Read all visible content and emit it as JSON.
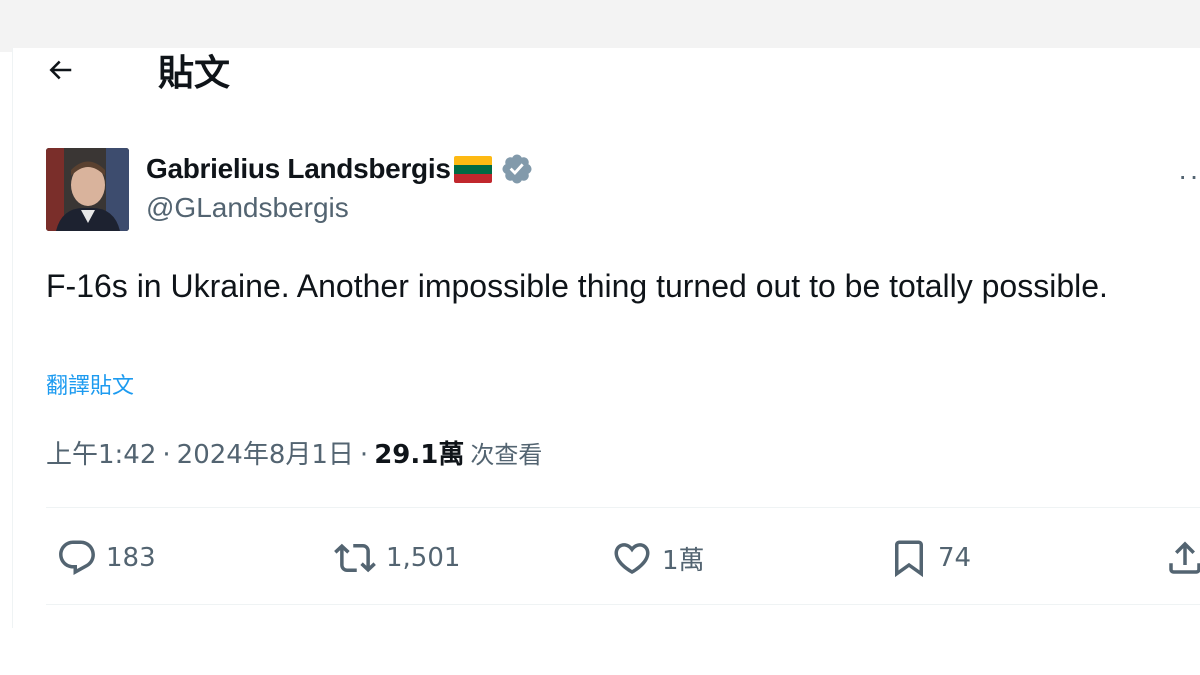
{
  "header": {
    "title": "貼文"
  },
  "author": {
    "display_name": "Gabrielius Landsbergis",
    "handle": "@GLandsbergis",
    "flag_colors": [
      "#fdb913",
      "#006a44",
      "#c1272d"
    ],
    "verified_color": "#829aab"
  },
  "tweet": {
    "text": "F-16s in Ukraine. Another impossible thing turned out to be totally possible.",
    "translate_label": "翻譯貼文",
    "time": "上午1:42",
    "separator": "·",
    "date": "2024年8月1日",
    "views_count": "29.1萬",
    "views_label": "次查看"
  },
  "actions": {
    "replies": "183",
    "reposts": "1,501",
    "likes": "1萬",
    "bookmarks": "74"
  },
  "colors": {
    "text_primary": "#0f1419",
    "text_secondary": "#536471",
    "link": "#1d9bf0",
    "border": "#eff3f4"
  }
}
